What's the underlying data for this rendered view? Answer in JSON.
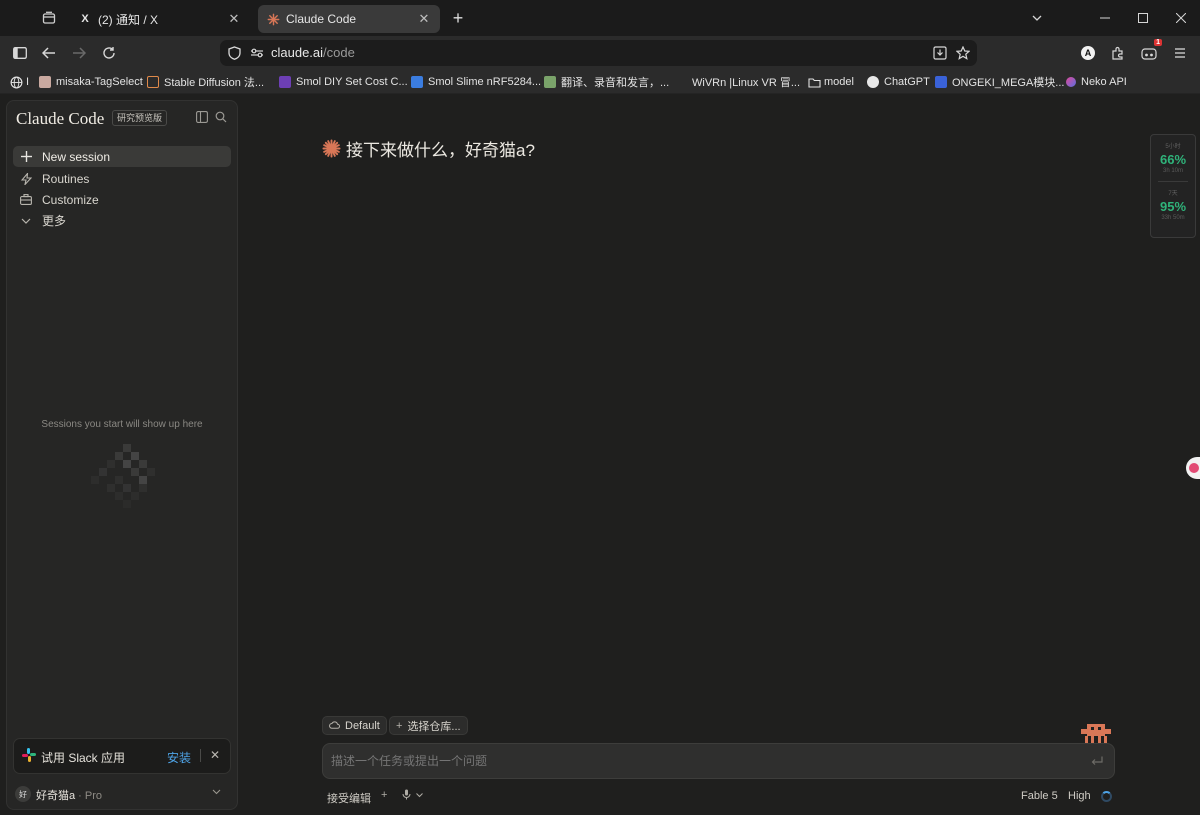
{
  "browser": {
    "tabs": [
      {
        "title": "(2) 通知 / X",
        "favicon": "x-logo-icon",
        "active": false
      },
      {
        "title": "Claude Code",
        "favicon": "claude-sparkle-icon",
        "active": true
      }
    ],
    "url_host": "claude.ai",
    "url_path": "/code",
    "extension_badge": "1",
    "profile_letter": "A",
    "bookmarks": [
      {
        "label": "I",
        "icon": "globe-icon"
      },
      {
        "label": "misaka-TagSelect",
        "icon": "anime-avatar-icon"
      },
      {
        "label": "Stable Diffusion 法...",
        "icon": "sd-icon"
      },
      {
        "label": "Smol DIY Set Cost C...",
        "icon": "smol-icon"
      },
      {
        "label": "Smol Slime nRF5284...",
        "icon": "slime-icon"
      },
      {
        "label": "翻译、录音和发言，...",
        "icon": "translate-icon"
      },
      {
        "label": "WiVRn |Linux VR 冒...",
        "icon": "none"
      },
      {
        "label": "model",
        "icon": "folder-icon"
      },
      {
        "label": "ChatGPT",
        "icon": "chatgpt-icon"
      },
      {
        "label": "ONGEKI_MEGA模块...",
        "icon": "ongeki-icon"
      },
      {
        "label": "Neko API",
        "icon": "neko-icon"
      }
    ]
  },
  "sidebar": {
    "brand": "Claude Code",
    "badge": "研究预览版",
    "nav": [
      {
        "label": "New session",
        "icon": "plus-icon",
        "selected": true
      },
      {
        "label": "Routines",
        "icon": "routine-icon",
        "selected": false
      },
      {
        "label": "Customize",
        "icon": "briefcase-icon",
        "selected": false
      },
      {
        "label": "更多",
        "icon": "chevron-down-icon",
        "selected": false
      }
    ],
    "empty_state": "Sessions you start will show up here",
    "slack": {
      "label": "试用 Slack 应用",
      "install": "安装"
    },
    "user": {
      "avatar": "好",
      "name": "好奇猫a",
      "plan": "Pro"
    }
  },
  "main": {
    "greeting": "接下来做什么，好奇猫a?",
    "chips": {
      "environment": "Default",
      "repo": "选择仓库..."
    },
    "composer_placeholder": "描述一个任务或提出一个问题",
    "footer": {
      "mode": "接受编辑",
      "model": "Fable 5",
      "effort": "High"
    }
  },
  "perf_widget": {
    "top_label": "5小时",
    "top_value": "66%",
    "top_sub": "3h 10m",
    "bottom_label": "7天",
    "bottom_value": "95%",
    "bottom_sub": "33h 50m"
  },
  "colors": {
    "accent": "#d97757",
    "link": "#4ea3e6",
    "ok": "#2fb37a"
  }
}
